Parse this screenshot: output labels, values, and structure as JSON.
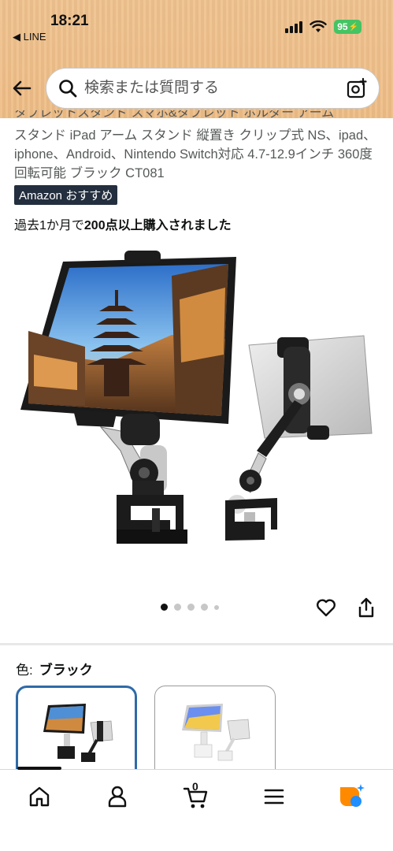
{
  "status": {
    "time": "18:21",
    "back_app": "◀ LINE",
    "battery": "95"
  },
  "search": {
    "placeholder": "検索または質問する"
  },
  "product": {
    "title_cut": "タブレットスタンド スマホ&タブレット ホルダー アーム",
    "title": "スタンド iPad アーム スタンド 縦置き クリップ式 NS、ipad、iphone、Android、Nintendo Switch対応 4.7-12.9インチ 360度回転可能 ブラック CT081",
    "badge": "Amazon おすすめ",
    "bought_prefix": "過去1か月で",
    "bought_bold": "200点以上購入されました"
  },
  "image_carousel": {
    "count": 5,
    "active_index": 0
  },
  "color_selector": {
    "label": "色:",
    "selected": "ブラック"
  },
  "nav": {
    "items": [
      "home-icon",
      "account-icon",
      "cart-icon",
      "menu-icon",
      "rufus-icon"
    ],
    "cart_count": "0"
  },
  "colors": {
    "header_bg": "#efc08a",
    "badge_bg": "#232f3e",
    "selected_border": "#2f6aa8",
    "battery": "#45c463",
    "rufus_orange": "#ff8a00",
    "rufus_blue": "#1f8eff"
  }
}
